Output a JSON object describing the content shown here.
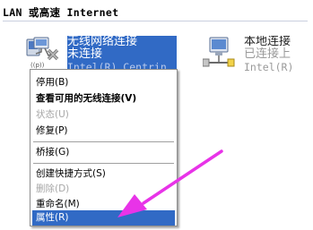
{
  "section": {
    "header": "LAN 或高速 Internet"
  },
  "connections": {
    "wireless": {
      "name": "无线网络连接",
      "status": "未连接",
      "device": "Intel(R) Centrin"
    },
    "local": {
      "name": "本地连接",
      "status": "已连接上",
      "device": "Intel(R)"
    }
  },
  "context_menu": {
    "items": [
      {
        "label": "停用(B)",
        "style": "normal"
      },
      {
        "label": "查看可用的无线连接(V)",
        "style": "bold"
      },
      {
        "label": "状态(U)",
        "style": "disabled"
      },
      {
        "label": "修复(P)",
        "style": "normal"
      },
      {
        "label": "桥接(G)",
        "style": "normal"
      },
      {
        "label": "创建快捷方式(S)",
        "style": "normal"
      },
      {
        "label": "删除(D)",
        "style": "disabled"
      },
      {
        "label": "重命名(M)",
        "style": "normal"
      },
      {
        "label": "属性(R)",
        "style": "highlighted"
      }
    ]
  },
  "colors": {
    "selection": "#316ac5",
    "arrow": "#e833e8",
    "disabled_text": "#a7a7a7"
  },
  "icons": [
    "wireless-connection-icon",
    "local-area-connection-icon",
    "annotation-arrow"
  ]
}
